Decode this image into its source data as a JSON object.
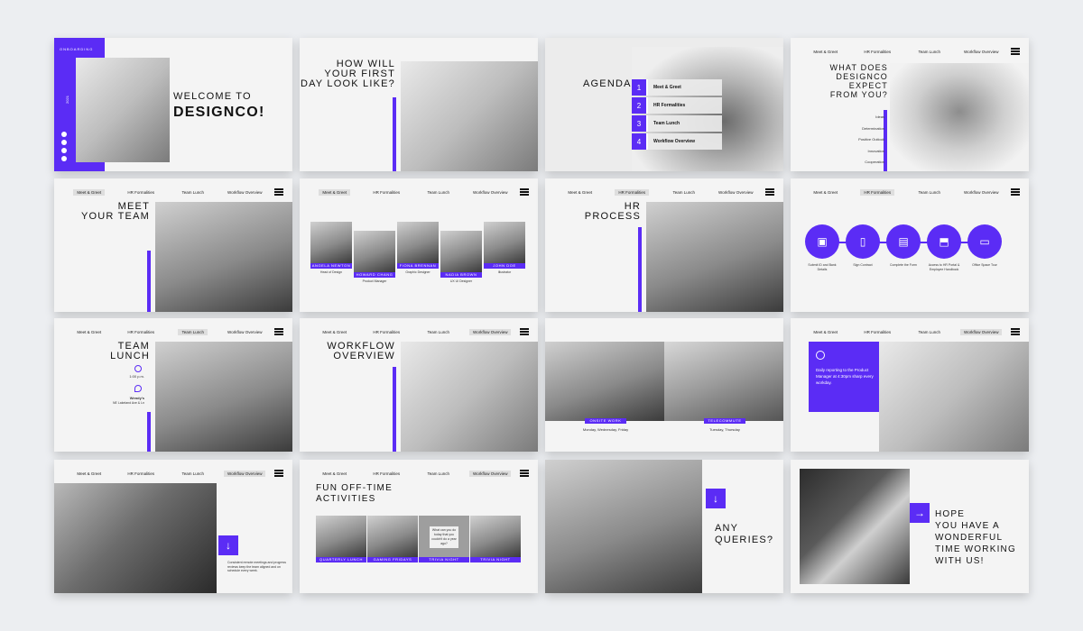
{
  "colors": {
    "accent": "#5b2cf5",
    "page_bg": "#eceef1",
    "slide_bg": "#f4f4f4"
  },
  "nav": [
    "Meet & Greet",
    "HR Formalities",
    "Team Lunch",
    "Workflow Overview"
  ],
  "s1": {
    "label": "ONBOARDING",
    "year": "2021",
    "title1": "WELCOME TO",
    "title2": "DESIGNCO!",
    "social": [
      "twitter-icon",
      "facebook-icon",
      "instagram-icon",
      "linkedin-icon"
    ]
  },
  "s2": {
    "title": "HOW WILL\nYOUR FIRST\nDAY LOOK LIKE?"
  },
  "s3": {
    "title": "AGENDA",
    "items": [
      {
        "n": "1",
        "label": "Meet & Greet"
      },
      {
        "n": "2",
        "label": "HR Formalities"
      },
      {
        "n": "3",
        "label": "Team Lunch"
      },
      {
        "n": "4",
        "label": "Workflow Overview"
      }
    ]
  },
  "s4": {
    "title": "WHAT DOES\nDESIGNCO\nEXPECT\nFROM YOU?",
    "traits": [
      "Ideas",
      "Determination",
      "Positive Outlook",
      "Innovation",
      "Cooperation"
    ]
  },
  "s5": {
    "title": "MEET\nYOUR TEAM"
  },
  "s6": {
    "people": [
      {
        "name": "ANGELA NEWTON",
        "role": "Head of Design"
      },
      {
        "name": "HOWARD CHANG",
        "role": "Product Manager"
      },
      {
        "name": "FIONA BRENNAN",
        "role": "Graphic Designer"
      },
      {
        "name": "NADIA BROWN",
        "role": "UX UI Designer"
      },
      {
        "name": "JOHN DOE",
        "role": "Illustrator"
      }
    ]
  },
  "s7": {
    "title": "HR\nPROCESS"
  },
  "s8": {
    "steps": [
      "Submit ID and Bank Details",
      "Sign Contract",
      "Complete the Form",
      "Access to HR Portal & Employee Handbook",
      "Office Space Tour"
    ]
  },
  "s9": {
    "title": "TEAM\nLUNCH",
    "time": "1:00 p.m.",
    "place": "Wendy's",
    "address": "NE Lakeland Ave & Ln"
  },
  "s10": {
    "title": "WORKFLOW\nOVERVIEW"
  },
  "s11": {
    "tags": [
      {
        "label": "ONSITE WORK",
        "days": "Monday, Wednesday, Friday"
      },
      {
        "label": "TELECOMMUTE",
        "days": "Tuesday, Thursday"
      }
    ]
  },
  "s12": {
    "text": "Daily reporting to the Product Manager at 4:30pm sharp every workday."
  },
  "s13": {
    "text": "Consistent remote meetings and progress reviews keep the team aligned and on schedule every week."
  },
  "s14": {
    "title": "FUN OFF-TIME\nACTIVITIES",
    "cards": [
      "QUARTERLY LUNCH",
      "GAMING FRIDAYS",
      "TRIVIA NIGHT",
      "TRIVIA NIGHT"
    ],
    "card3_text": "What can you do today that you couldn't do a year ago?"
  },
  "s15": {
    "title": "ANY\nQUERIES?"
  },
  "s16": {
    "title": "HOPE\nYOU HAVE A\nWONDERFUL\nTIME WORKING\nWITH US!"
  }
}
